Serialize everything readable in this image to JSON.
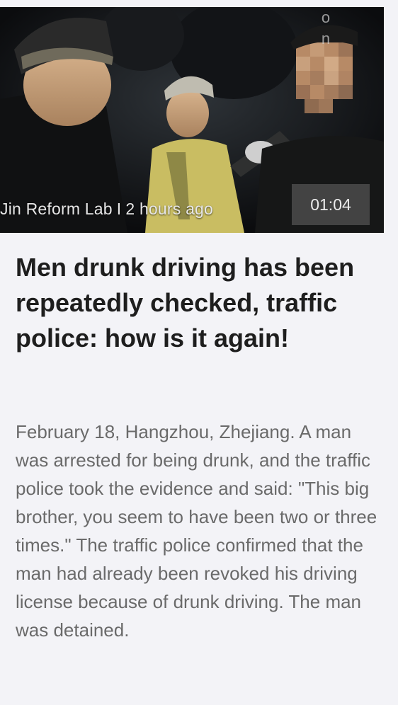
{
  "video": {
    "source": "Jin Reform Lab",
    "separator": "I",
    "time_ago": "2 hours ago",
    "duration": "01:04",
    "watermark_letters": [
      "o",
      "n"
    ]
  },
  "article": {
    "headline": "Men drunk driving has been repeatedly checked, traffic police: how is it again!",
    "body": "February 18, Hangzhou, Zhejiang. A man was arrested for being drunk, and the traffic police took the evidence and said: \"This big brother, you seem to have been two or three times.\" The traffic police confirmed that the man had already been revoked his driving license because of drunk driving. The man was detained."
  },
  "colors": {
    "background": "#f3f3f7",
    "headline": "#1e1e1e",
    "body": "#6a6a6a",
    "duration_badge": "#555555",
    "police_vest": "#c9bd62"
  }
}
